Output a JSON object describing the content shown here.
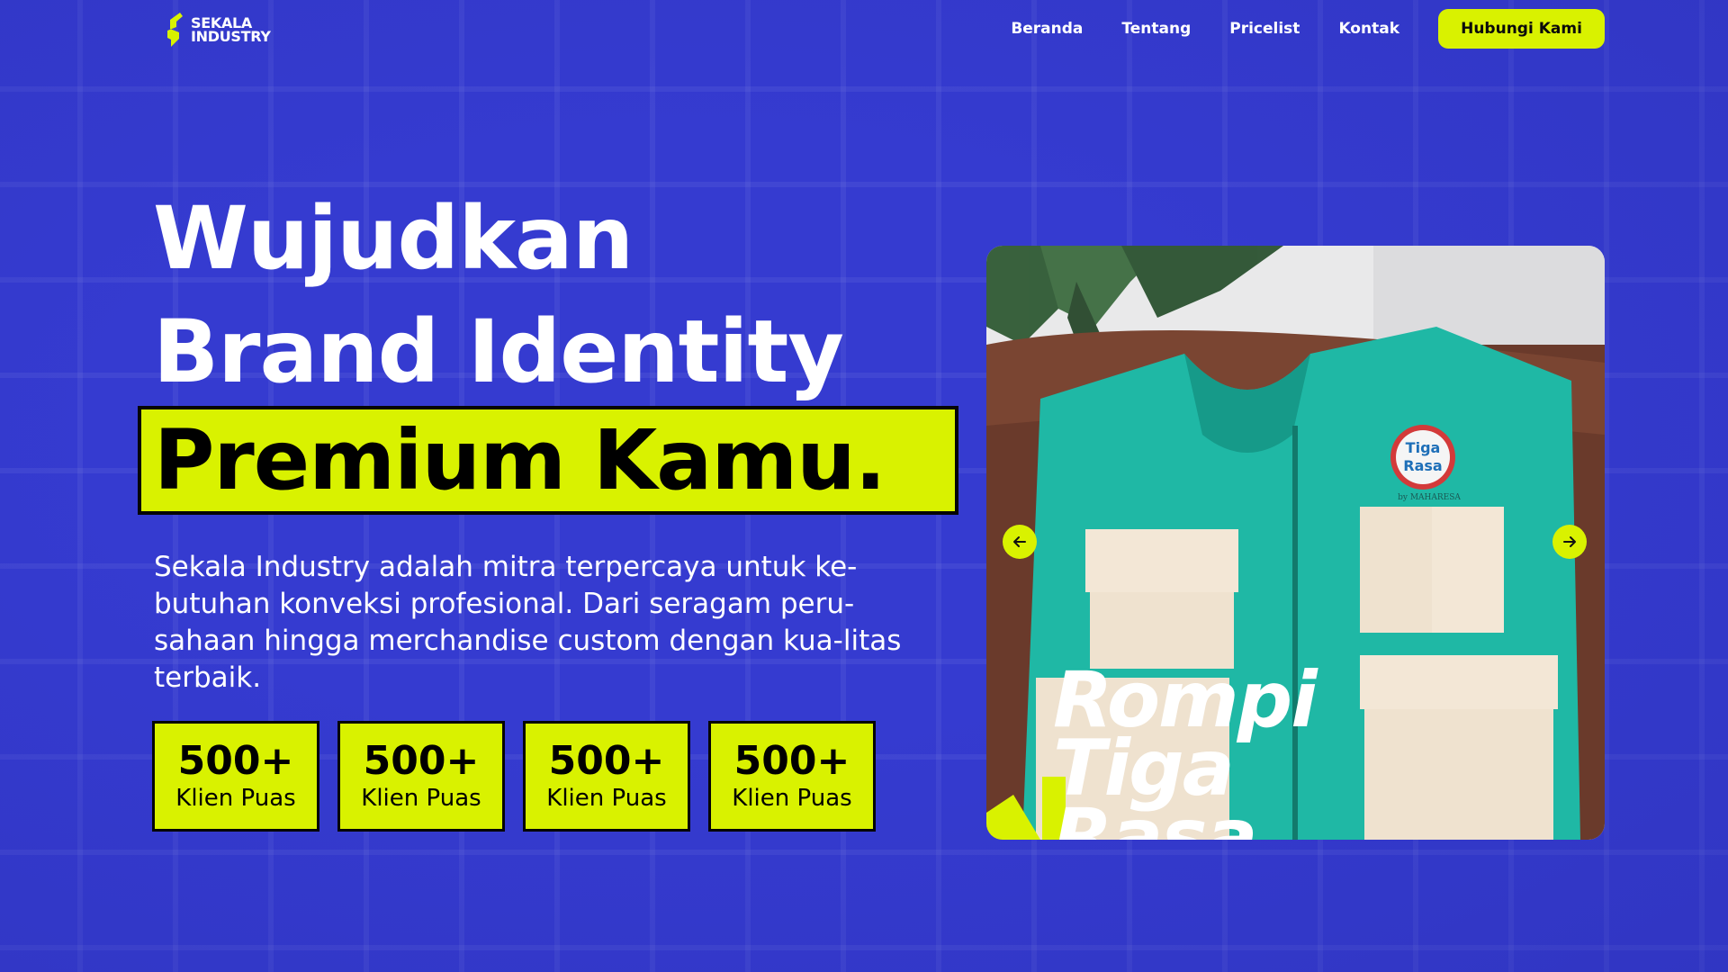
{
  "brand": {
    "logo_line1": "SEKALA",
    "logo_line2": "INDUSTRY",
    "accent": "#d9f200",
    "background": "#353bd0"
  },
  "nav": {
    "links": [
      "Beranda",
      "Tentang",
      "Pricelist",
      "Kontak"
    ],
    "cta": "Hubungi Kami"
  },
  "hero": {
    "line1": "Wujudkan",
    "line2": "Brand Identity",
    "highlight": "Premium Kamu.",
    "description": "Sekala Industry adalah mitra terpercaya untuk ke-butuhan konveksi profesional. Dari seragam peru-sahaan hingga merchandise custom dengan kua-litas terbaik.",
    "stats": [
      {
        "value": "500+",
        "label": "Klien Puas"
      },
      {
        "value": "500+",
        "label": "Klien Puas"
      },
      {
        "value": "500+",
        "label": "Klien Puas"
      },
      {
        "value": "500+",
        "label": "Klien Puas"
      }
    ]
  },
  "carousel": {
    "slide_title_line1": "Rompi",
    "slide_title_line2": "Tiga",
    "slide_title_line3": "Rasa",
    "patch_line1": "Tiga",
    "patch_line2": "Rasa",
    "patch_sub": "by MAHARESA",
    "prev_icon": "arrow-left-icon",
    "next_icon": "arrow-right-icon"
  }
}
